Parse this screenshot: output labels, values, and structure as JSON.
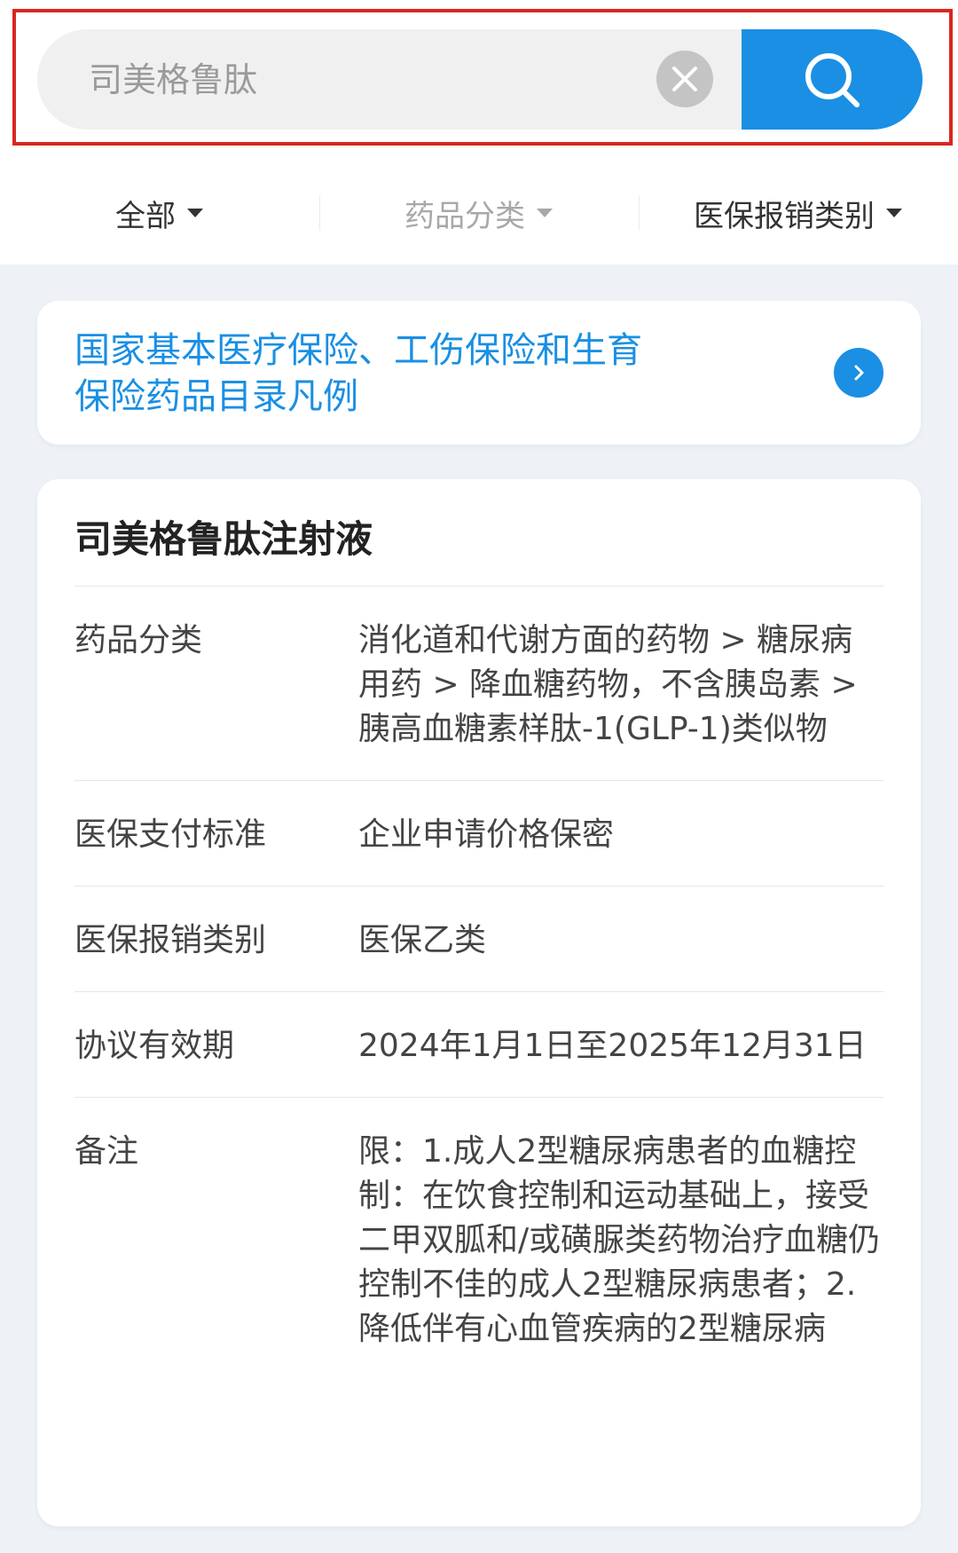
{
  "search": {
    "placeholder": "司美格鲁肽",
    "value": ""
  },
  "icons": {
    "clear": "close-circle-icon",
    "search": "search-icon",
    "dropdown": "caret-down-icon",
    "banner_arrow": "chevron-right-icon"
  },
  "colors": {
    "accent": "#1a8fe3",
    "highlight_frame": "#d9271e"
  },
  "filters": {
    "all": "全部",
    "category": "药品分类",
    "reimbursement": "医保报销类别"
  },
  "banner": {
    "line1": "国家基本医疗保险、工伤保险和生育",
    "line2": "保险药品目录凡例"
  },
  "drug": {
    "title": "司美格鲁肽注射液",
    "rows": [
      {
        "label": "药品分类",
        "value": "消化道和代谢方面的药物 > 糖尿病用药 > 降血糖药物，不含胰岛素 > 胰高血糖素样肽-1(GLP-1)类似物"
      },
      {
        "label": "医保支付标准",
        "value": "企业申请价格保密"
      },
      {
        "label": "医保报销类别",
        "value": "医保乙类"
      },
      {
        "label": "协议有效期",
        "value": "2024年1月1日至2025年12月31日"
      },
      {
        "label": "备注",
        "value": "限：1.成人2型糖尿病患者的血糖控制：在饮食控制和运动基础上，接受二甲双胍和/或磺脲类药物治疗血糖仍控制不佳的成人2型糖尿病患者；2.降低伴有心血管疾病的2型糖尿病"
      }
    ]
  }
}
